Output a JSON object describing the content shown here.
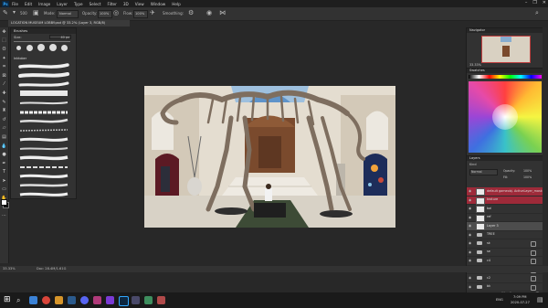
{
  "app": {
    "logo": "Ps",
    "menus": [
      "File",
      "Edit",
      "Image",
      "Layer",
      "Type",
      "Select",
      "Filter",
      "3D",
      "View",
      "Window",
      "Help"
    ],
    "window_controls": [
      "–",
      "❐",
      "✕"
    ]
  },
  "options": {
    "size": "500",
    "mode_label": "Mode:",
    "mode_value": "Normal",
    "opacity_label": "Opacity:",
    "opacity_value": "100%",
    "flow_label": "Flow:",
    "flow_value": "100%",
    "smoothing_label": "Smoothing:"
  },
  "document": {
    "tab_title": "LOCATION MUSEUM LOBBY.psd @ 33.2% (Layer 3, RGB/8)"
  },
  "brushes_panel": {
    "title": "Brushes",
    "size_label": "Size:",
    "size_value": "40 px",
    "group_label": "Inktober"
  },
  "navigator": {
    "title": "Navigator",
    "zoom": "33.33%"
  },
  "swatches": {
    "title": "Swatches"
  },
  "layers_panel": {
    "title": "Layers",
    "kind_label": "Kind",
    "blend_value": "Normal",
    "opacity_label": "Opacity:",
    "opacity_value": "100%",
    "fill_label": "Fill:",
    "fill_value": "100%",
    "layers": [
      {
        "name": "default gameobj. ActiveLayer_mask",
        "type": "layer",
        "highlight": true
      },
      {
        "name": "texture",
        "type": "layer",
        "highlight": true
      },
      {
        "name": "bal",
        "type": "layer",
        "highlight": false
      },
      {
        "name": "ref",
        "type": "layer",
        "highlight": false
      },
      {
        "name": "Layer 3",
        "type": "layer",
        "highlight": false,
        "selected": true
      },
      {
        "name": "TREE",
        "type": "folder",
        "highlight": false
      },
      {
        "name": "sk",
        "type": "folder",
        "highlight": false
      },
      {
        "name": "se",
        "type": "folder",
        "highlight": false
      },
      {
        "name": "c4",
        "type": "folder",
        "highlight": false
      },
      {
        "name": "c3",
        "type": "folder",
        "highlight": false
      },
      {
        "name": "c2",
        "type": "folder",
        "highlight": false
      },
      {
        "name": "bk",
        "type": "folder",
        "highlight": false
      }
    ]
  },
  "status": {
    "zoom": "33.33%",
    "doc": "Doc: 28.4M/1.61G"
  },
  "taskbar": {
    "time": "7:09 PM",
    "date": "2020-07-27",
    "lang": "ENG"
  },
  "colors": {
    "accent": "#31a8ff",
    "layer_highlight": "#9e2a39",
    "layer_selected": "#4d4d4d"
  }
}
